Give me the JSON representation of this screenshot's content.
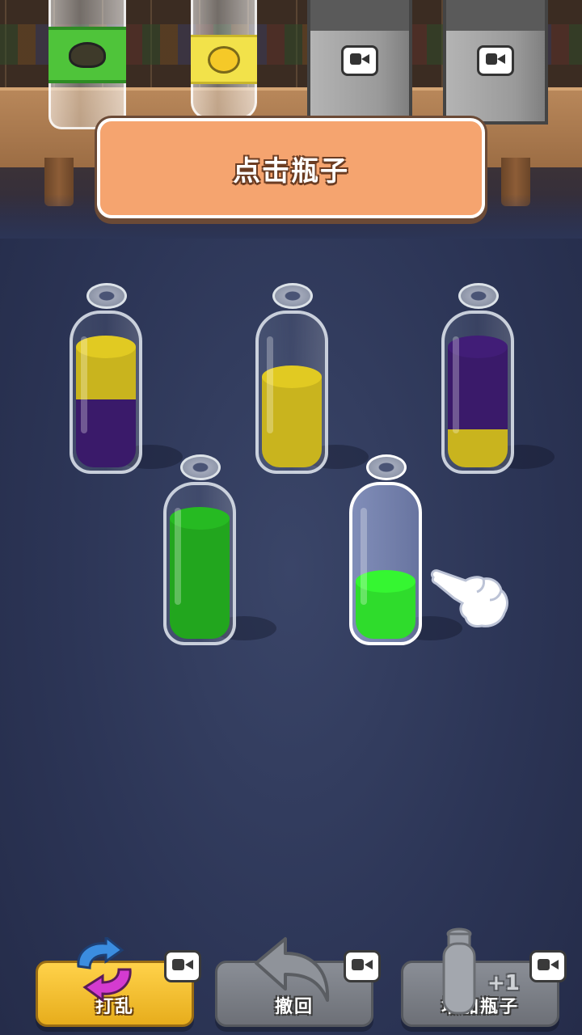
{
  "banner": {
    "text": "点击瓶子"
  },
  "shelf": {
    "cups": [
      {
        "name": "matcha-cup",
        "liquid_color": "#4fc43a",
        "icon": "matcha-bowl-icon"
      },
      {
        "name": "lemon-cup",
        "liquid_color": "#f2e24a",
        "icon": "lemon-icon"
      }
    ],
    "locked_items": [
      {
        "name": "locked-bag-1",
        "icon": "video-ad-icon"
      },
      {
        "name": "locked-bag-2",
        "icon": "video-ad-icon"
      }
    ]
  },
  "colors": {
    "yellow": "#c9b41e",
    "purple": "#3a1a6a",
    "green": "#22a61e",
    "bright_green": "#2fdc2c",
    "banner_bg": "#f5a46f"
  },
  "bottles": [
    {
      "id": "bottle-1",
      "selected": false,
      "layers": [
        {
          "color": "purple",
          "fraction": 0.45
        },
        {
          "color": "yellow",
          "fraction": 0.35
        }
      ]
    },
    {
      "id": "bottle-2",
      "selected": false,
      "layers": [
        {
          "color": "yellow",
          "fraction": 0.6
        }
      ]
    },
    {
      "id": "bottle-3",
      "selected": false,
      "layers": [
        {
          "color": "yellow",
          "fraction": 0.25
        },
        {
          "color": "purple",
          "fraction": 0.55
        }
      ]
    },
    {
      "id": "bottle-4",
      "selected": false,
      "layers": [
        {
          "color": "green",
          "fraction": 0.8
        }
      ]
    },
    {
      "id": "bottle-5",
      "selected": true,
      "layers": [
        {
          "color": "bright_green",
          "fraction": 0.38
        }
      ]
    }
  ],
  "buttons": {
    "shuffle": {
      "label": "打乱",
      "icon": "shuffle-arrows-icon",
      "requires_video": true
    },
    "undo": {
      "label": "撤回",
      "icon": "undo-arrow-icon",
      "requires_video": true
    },
    "add_bottle": {
      "label": "增加瓶子",
      "icon": "bottle-icon",
      "badge": "+1",
      "requires_video": true
    }
  }
}
